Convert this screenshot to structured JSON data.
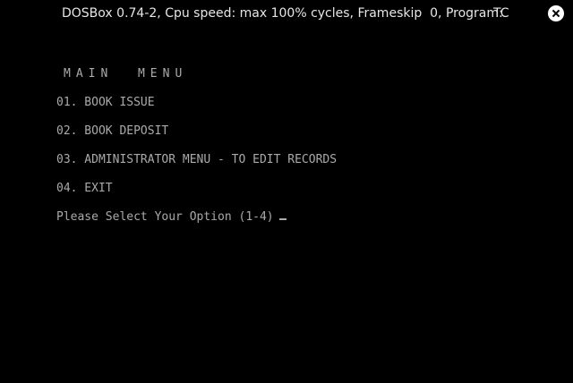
{
  "window": {
    "title": "DOSBox 0.74-2, Cpu speed: max 100% cycles, Frameskip  0, Program:",
    "program": "TC"
  },
  "screen": {
    "heading": "MAIN  MENU",
    "menu_items": [
      "01. BOOK ISSUE",
      "02. BOOK DEPOSIT",
      "03. ADMINISTRATOR MENU - TO EDIT RECORDS",
      "04. EXIT"
    ],
    "prompt": "Please Select Your Option (1-4)"
  },
  "colors": {
    "background": "#000000",
    "text": "#aaaaaa",
    "title_text": "#e6e6e6"
  }
}
